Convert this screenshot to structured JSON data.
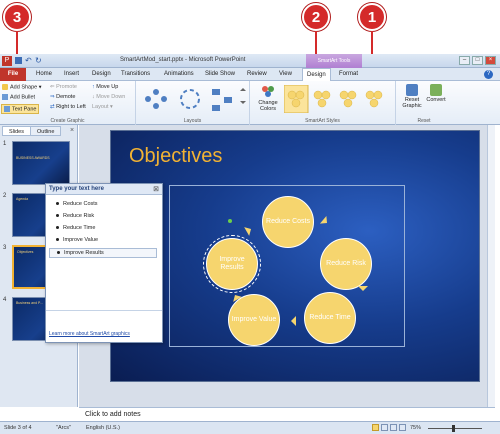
{
  "callouts": [
    "3",
    "2",
    "1"
  ],
  "window": {
    "title": "SmartArtMod_start.pptx - Microsoft PowerPoint",
    "contextual_tab_group": "SmartArt Tools",
    "controls": [
      "–",
      "□",
      "×"
    ]
  },
  "tabs": [
    "File",
    "Home",
    "Insert",
    "Design",
    "Transitions",
    "Animations",
    "Slide Show",
    "Review",
    "View",
    "Design",
    "Format"
  ],
  "active_tab_index": 9,
  "ribbon": {
    "create_graphic": {
      "label": "Create Graphic",
      "buttons": [
        "Add Shape",
        "Add Bullet",
        "Text Pane",
        "Promote",
        "Demote",
        "Right to Left",
        "Move Up",
        "Move Down",
        "Layout"
      ]
    },
    "layouts": {
      "label": "Layouts"
    },
    "smartart_styles": {
      "label": "SmartArt Styles",
      "change_colors": "Change Colors"
    },
    "reset": {
      "label": "Reset",
      "reset_graphic": "Reset Graphic",
      "convert": "Convert"
    }
  },
  "left_pane": {
    "tabs": [
      "Slides",
      "Outline"
    ],
    "close": "×",
    "slides": [
      {
        "num": "1",
        "caption": "BUSINESS AWARDS"
      },
      {
        "num": "2",
        "caption": "Agenda"
      },
      {
        "num": "3",
        "caption": "Objectives"
      },
      {
        "num": "4",
        "caption": "Business and P..."
      }
    ]
  },
  "slide": {
    "title": "Objectives",
    "circles": [
      "Reduce Costs",
      "Reduce Risk",
      "Reduce Time",
      "Improve Value",
      "Improve Results"
    ]
  },
  "text_pane": {
    "title": "Type your text here",
    "close": "⊠",
    "items": [
      "Reduce Costs",
      "Reduce Risk",
      "Reduce Time",
      "Improve Value",
      "Improve Results"
    ],
    "link": "Learn more about SmartArt graphics"
  },
  "notes": {
    "placeholder": "Click to add notes"
  },
  "status": {
    "slide": "Slide 3 of 4",
    "theme": "\"Arcs\"",
    "language": "English (U.S.)",
    "zoom": "75%"
  },
  "colors": {
    "accent_red": "#d42a2a",
    "file_tab": "#c0352b",
    "smartart_tools": "#b07fd2",
    "circle_fill": "#f6d56e",
    "title_gold": "#f2b233"
  }
}
